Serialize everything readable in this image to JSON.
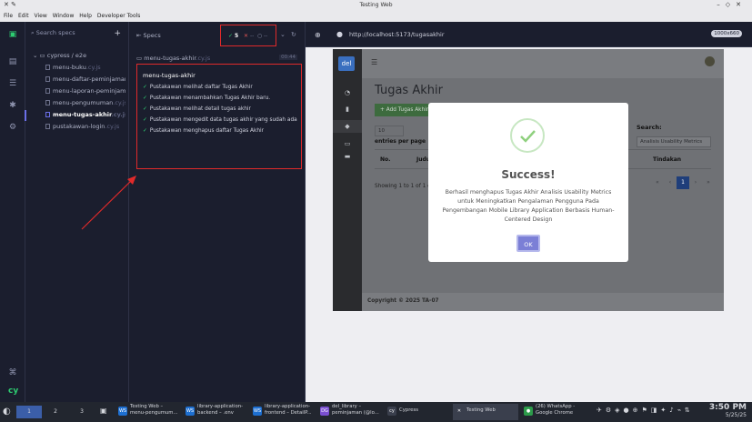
{
  "window": {
    "title": "Testing Web"
  },
  "menu": [
    "File",
    "Edit",
    "View",
    "Window",
    "Help",
    "Developer Tools"
  ],
  "specs_panel": {
    "search_placeholder": "Search specs",
    "folder": "cypress / e2e",
    "ext": ".cy.js",
    "items": [
      "menu-buku",
      "menu-daftar-peminjaman-...",
      "menu-laporan-peminjama...",
      "menu-pengumuman",
      "menu-tugas-akhir",
      "pustakawan-login"
    ]
  },
  "runner": {
    "header": "Specs",
    "passed": "5",
    "failed": "--",
    "pending": "--",
    "file": "menu-tugas-akhir",
    "file_ext": ".cy.js",
    "duration": "00:44",
    "suite": "menu-tugas-akhir",
    "tests": [
      "Pustakawan melihat daftar Tugas Akhir",
      "Pustakawan menambahkan Tugas Akhir baru.",
      "Pustakawan melihat detail tugas akhir",
      "Pustakawan mengedit data tugas akhir yang sudah ada",
      "Pustakawan menghapus daftar Tugas Akhir"
    ]
  },
  "preview": {
    "url": "http://localhost:5173/tugasakhir",
    "viewport": "1000x660"
  },
  "app": {
    "logo": "del",
    "page_title": "Tugas Akhir",
    "add_button": "+ Add Tugas Akhir",
    "entries_value": "10",
    "entries_label": "entries per page",
    "search_label": "Search:",
    "search_value": "Analisis Usability Metrics",
    "columns": [
      "No.",
      "Judul",
      "Tindakan"
    ],
    "showing": "Showing 1 to 1 of 1 entries",
    "pager": [
      "«",
      "‹",
      "1",
      "›",
      "»"
    ],
    "footer": "Copyright © 2025 TA-07"
  },
  "modal": {
    "title": "Success!",
    "message": "Berhasil menghapus Tugas Akhir Analisis Usability Metrics untuk Meningkatkan Pengalaman Pengguna Pada Pengembangan Mobile Library Application Berbasis Human-Centered Design",
    "ok": "OK"
  },
  "taskbar": {
    "workspaces": [
      "1",
      "2",
      "3"
    ],
    "tasks": [
      {
        "line1": "Testing Web –",
        "line2": "menu-pengumum...",
        "icon": "WS",
        "color": "#1d6fd1"
      },
      {
        "line1": "library-application-",
        "line2": "backend – .env",
        "icon": "WS",
        "color": "#1d6fd1"
      },
      {
        "line1": "library-application-",
        "line2": "frontend – DetailP...",
        "icon": "WS",
        "color": "#1d6fd1"
      },
      {
        "line1": "del_library –",
        "line2": "peminjaman (@lo...",
        "icon": "DG",
        "color": "#7a4fd1"
      },
      {
        "line1": "Cypress",
        "line2": "",
        "icon": "cy",
        "color": "#3a3f4d"
      },
      {
        "line1": "Testing Web",
        "line2": "",
        "icon": "✕",
        "color": "#3a3f4d"
      },
      {
        "line1": "(26) WhatsApp -",
        "line2": "Google Chrome",
        "icon": "●",
        "color": "#2c9b4a"
      }
    ],
    "time": "3:50 PM",
    "date": "5/25/25"
  }
}
